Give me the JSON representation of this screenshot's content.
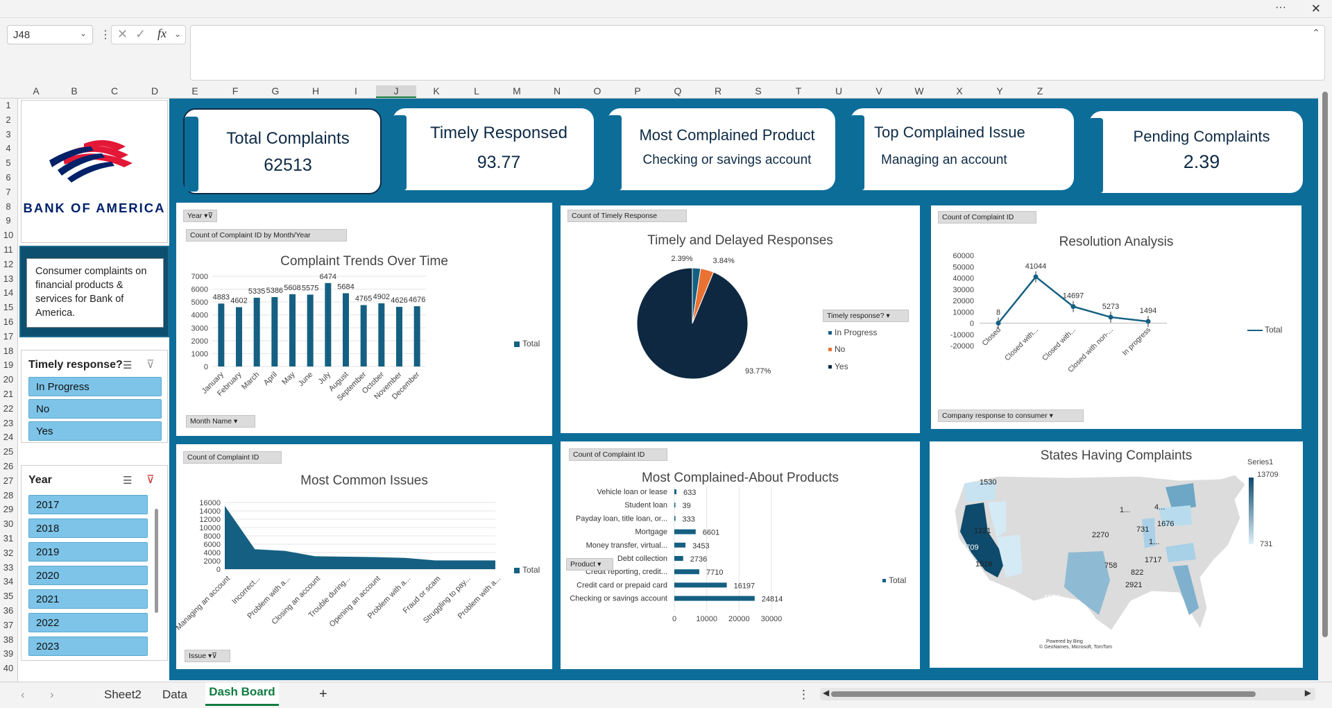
{
  "window": {
    "more_label": "···",
    "close_label": "✕"
  },
  "formula_bar": {
    "cell_ref": "J48",
    "fx_label": "fx",
    "cancel": "✕",
    "confirm": "✓",
    "formula_value": ""
  },
  "columns": [
    "A",
    "B",
    "C",
    "D",
    "E",
    "F",
    "G",
    "H",
    "I",
    "J",
    "K",
    "L",
    "M",
    "N",
    "O",
    "P",
    "Q",
    "R",
    "S",
    "T",
    "U",
    "V",
    "W",
    "X",
    "Y",
    "Z"
  ],
  "rows": [
    "1",
    "2",
    "3",
    "4",
    "5",
    "6",
    "7",
    "8",
    "9",
    "10",
    "11",
    "12",
    "13",
    "14",
    "15",
    "16",
    "17",
    "18",
    "19",
    "20",
    "21",
    "22",
    "23",
    "24",
    "25",
    "26",
    "27",
    "28",
    "29",
    "30",
    "31",
    "32",
    "33",
    "34",
    "35",
    "36",
    "37",
    "38",
    "39",
    "40"
  ],
  "logo": {
    "text": "BANK OF AMERICA"
  },
  "description": "Consumer complaints on financial products & services for Bank of America.",
  "slicers": {
    "timely": {
      "title": "Timely response?",
      "items": [
        "In Progress",
        "No",
        "Yes"
      ]
    },
    "year": {
      "title": "Year",
      "items": [
        "2017",
        "2018",
        "2019",
        "2020",
        "2021",
        "2022",
        "2023"
      ]
    }
  },
  "kpis": [
    {
      "title": "Total Complaints",
      "value": "62513"
    },
    {
      "title": "Timely Responsed",
      "value": "93.77"
    },
    {
      "title": "Most Complained Product",
      "value": "Checking or savings account"
    },
    {
      "title": "Top Complained Issue",
      "value": "Managing an account"
    },
    {
      "title": "Pending Complaints",
      "value": "2.39"
    }
  ],
  "trend": {
    "year_btn": "Year",
    "field_btn": "Count of Complaint ID by Month/Year",
    "axis_btn": "Month Name",
    "legend": "Total",
    "chart_data": {
      "type": "bar",
      "title": "Complaint Trends Over Time",
      "categories": [
        "January",
        "February",
        "March",
        "April",
        "May",
        "June",
        "July",
        "August",
        "September",
        "October",
        "November",
        "December"
      ],
      "values": [
        4883,
        4602,
        5335,
        5386,
        5608,
        5575,
        6474,
        5684,
        4765,
        4902,
        4626,
        4676
      ],
      "yticks": [
        "7000",
        "6000",
        "5000",
        "4000",
        "3000",
        "2000",
        "1000",
        "0"
      ],
      "ylim": [
        0,
        7000
      ]
    }
  },
  "timely_pie": {
    "field_btn": "Count of Timely Response",
    "filter_btn": "Timely response?",
    "legend": [
      "In Progress",
      "No",
      "Yes"
    ],
    "colors": [
      "#156082",
      "#e97132",
      "#0e2841"
    ],
    "chart_data": {
      "type": "pie",
      "title": "Timely and Delayed Responses",
      "labels": [
        "In Progress",
        "No",
        "Yes"
      ],
      "values": [
        2.39,
        3.84,
        93.77
      ],
      "data_labels": [
        "2.39%",
        "3.84%",
        "93.77%"
      ]
    }
  },
  "resolution": {
    "field_btn": "Count of Complaint ID",
    "axis_btn": "Company response to consumer",
    "legend": "Total",
    "chart_data": {
      "type": "line",
      "title": "Resolution Analysis",
      "categories": [
        "Closed",
        "Closed with...",
        "Closed with...",
        "Closed with non-...",
        "In progress"
      ],
      "values": [
        8,
        41044,
        14697,
        5273,
        1494
      ],
      "yticks": [
        "60000",
        "50000",
        "40000",
        "30000",
        "20000",
        "10000",
        "0",
        "-10000",
        "-20000"
      ],
      "ylim": [
        -20000,
        60000
      ]
    }
  },
  "issues": {
    "field_btn": "Count of Complaint ID",
    "axis_btn": "Issue",
    "legend": "Total",
    "chart_data": {
      "type": "area",
      "title": "Most Common Issues",
      "categories": [
        "Managing an account",
        "Incorrect...",
        "Problem with a...",
        "Closing an account",
        "Trouble during...",
        "Opening an account",
        "Problem with a...",
        "Fraud or scam",
        "Struggling to pay...",
        "Problem with a..."
      ],
      "values": [
        15200,
        4800,
        4400,
        3100,
        3000,
        2900,
        2700,
        2100,
        2100,
        2100
      ],
      "yticks": [
        "16000",
        "14000",
        "12000",
        "10000",
        "8000",
        "6000",
        "4000",
        "2000",
        "0"
      ],
      "ylim": [
        0,
        16000
      ]
    }
  },
  "products": {
    "field_btn": "Count of Complaint ID",
    "axis_btn": "Product",
    "legend": "Total",
    "chart_data": {
      "type": "bar",
      "orientation": "horizontal",
      "title": "Most Complained-About Products",
      "categories": [
        "Vehicle loan or lease",
        "Student loan",
        "Payday loan, title loan, or...",
        "Mortgage",
        "Money transfer, virtual...",
        "Debt collection",
        "Credit reporting, credit...",
        "Credit card or prepaid card",
        "Checking or savings account"
      ],
      "values": [
        633,
        39,
        333,
        6601,
        3453,
        2736,
        7710,
        16197,
        24814
      ],
      "xticks": [
        "0",
        "10000",
        "20000",
        "30000"
      ],
      "xlim": [
        0,
        30000
      ]
    }
  },
  "states": {
    "title": "States Having Complaints",
    "legend_title": "Series1",
    "legend_max": "13709",
    "legend_min": "731",
    "labels": [
      "1530",
      "1221",
      "13709",
      "1516",
      "4686",
      "2270",
      "1...",
      "731",
      "1676",
      "1...",
      "1717",
      "758",
      "822",
      "2921",
      "4..."
    ],
    "credit": "Powered by Bing",
    "copyright": "© GeoNames, Microsoft, TomTom"
  },
  "sheet_tabs": {
    "tabs": [
      "Sheet2",
      "Data",
      "Dash Board"
    ],
    "active": "Dash Board",
    "add": "+"
  }
}
